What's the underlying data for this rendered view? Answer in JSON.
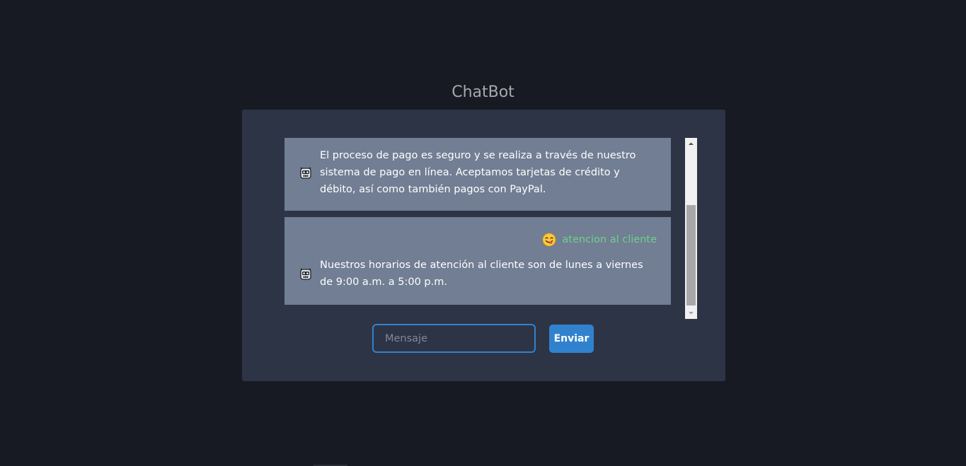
{
  "page": {
    "title": "ChatBot"
  },
  "messages": [
    {
      "bot_icon": "robot-face-icon",
      "bot_text": "El proceso de pago es seguro y se realiza a través de nuestro sistema de pago en línea. Aceptamos tarjetas de crédito y débito, así como también pagos con PayPal."
    },
    {
      "user_icon": "face-savoring-food-emoji-icon",
      "user_text": "atencion al cliente",
      "bot_icon": "robot-face-icon",
      "bot_text": "Nuestros horarios de atención al cliente son de lunes a viernes de 9:00 a.m. a 5:00 p.m."
    }
  ],
  "composer": {
    "input_value": "",
    "input_placeholder": "Mensaje",
    "send_label": "Enviar"
  },
  "colors": {
    "background": "#181a23",
    "panel": "#2d3446",
    "message_card": "#717e93",
    "user_text": "#6fd08c",
    "accent": "#3182ce"
  }
}
